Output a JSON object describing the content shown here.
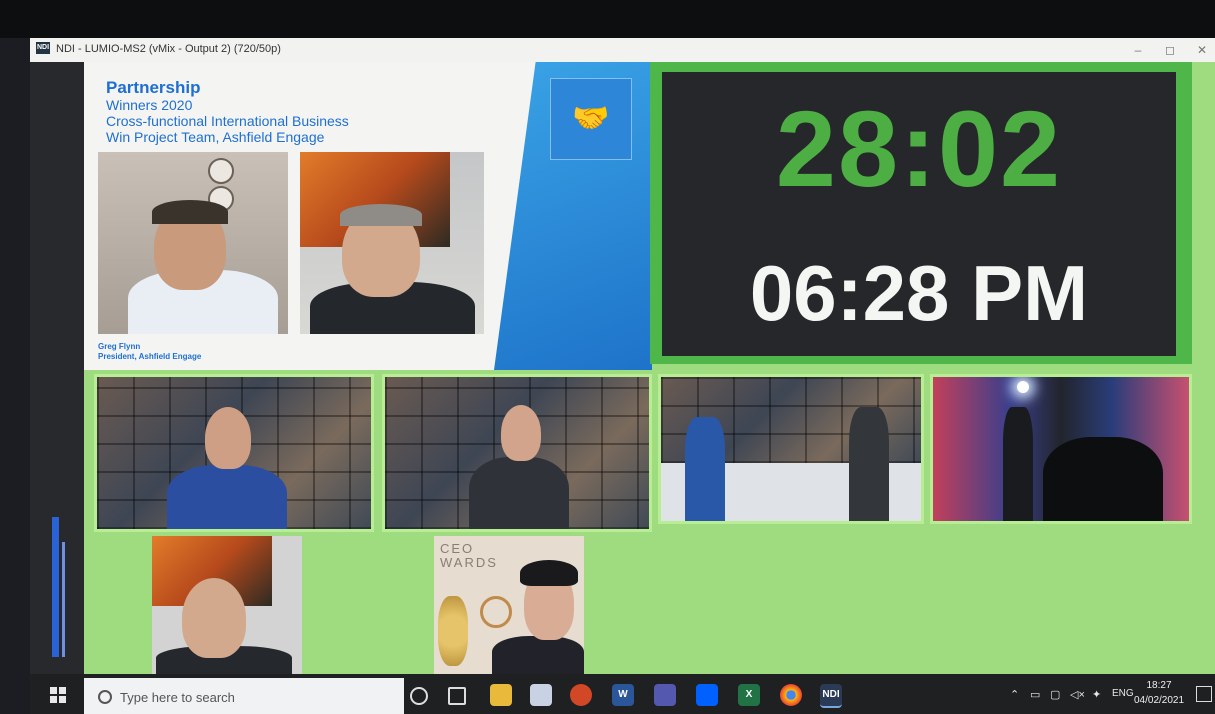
{
  "window": {
    "title": "NDI - LUMIO-MS2 (vMix - Output 2) (720/50p)",
    "app_icon": "NDI",
    "controls": [
      "–",
      "◻",
      "✕"
    ]
  },
  "award": {
    "heading": "Partnership",
    "line1": "Winners 2020",
    "line2": "Cross-functional International Business",
    "line3": "Win Project Team, Ashfield Engage",
    "caption_name": "Greg Flynn",
    "caption_role": "President, Ashfield Engage"
  },
  "clock": {
    "countdown": "28:02",
    "time": "06:28 PM"
  },
  "tiles": {
    "backdrop_text": "CEO\nWARDS"
  },
  "taskbar": {
    "search_placeholder": "Type here to search",
    "tray_lang": "ENG",
    "time": "18:27",
    "date": "04/02/2021",
    "ndi_label": "NDI",
    "icons": [
      "cortana-icon",
      "task-view-icon",
      "file-explorer-icon",
      "snipping-icon",
      "powerpoint-icon",
      "word-icon",
      "teams-icon",
      "dropbox-icon",
      "excel-icon",
      "chrome-icon",
      "ndi-icon"
    ]
  },
  "colors": {
    "clock_green": "#4dae43",
    "award_blue": "#1f6fd1",
    "output_green": "#9fdc7f"
  }
}
